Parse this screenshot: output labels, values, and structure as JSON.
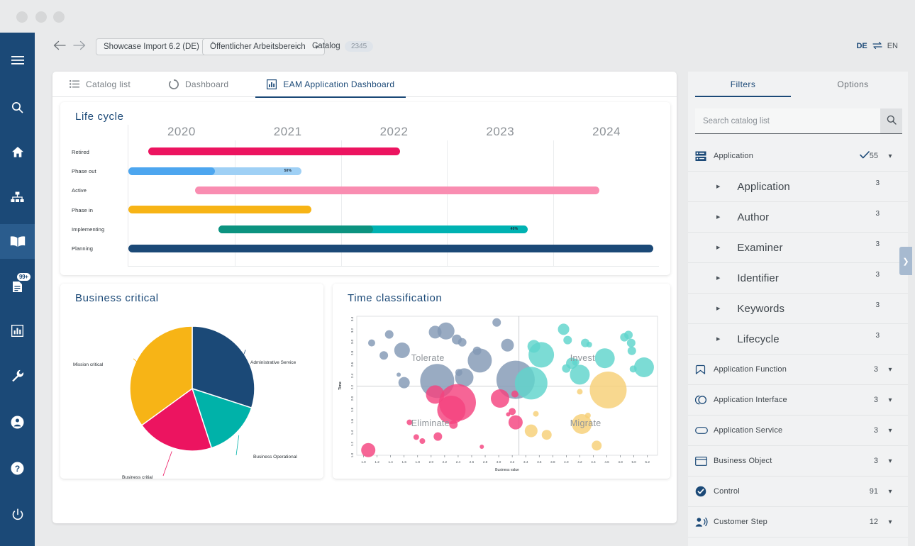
{
  "window": {
    "dots": [
      "minimize",
      "maximize",
      "close"
    ]
  },
  "left_rail": {
    "items": [
      {
        "name": "menu",
        "icon": "hamburger-icon",
        "active": false
      },
      {
        "name": "search",
        "icon": "search-icon",
        "active": false
      },
      {
        "name": "home",
        "icon": "home-icon",
        "active": false
      },
      {
        "name": "organization",
        "icon": "org-chart-icon",
        "active": false
      },
      {
        "name": "catalog",
        "icon": "book-icon",
        "active": true
      },
      {
        "name": "tasks",
        "icon": "document-icon",
        "active": false,
        "badge": "99+"
      },
      {
        "name": "reports",
        "icon": "bar-chart-icon",
        "active": false
      },
      {
        "name": "tools",
        "icon": "wrench-icon",
        "active": false
      }
    ],
    "bottom_items": [
      {
        "name": "account",
        "icon": "user-circle-icon"
      },
      {
        "name": "help",
        "icon": "question-circle-icon"
      },
      {
        "name": "logout",
        "icon": "power-icon"
      }
    ]
  },
  "top_bar": {
    "back_icon": "arrow-left-icon",
    "forward_icon": "arrow-right-icon",
    "import_select": "Showcase Import 6.2 (DE)",
    "workspace_select": "Öffentlicher Arbeitsbereich",
    "catalog_label": "Catalog",
    "catalog_count": "2345",
    "lang_de": "DE",
    "lang_en": "EN",
    "lang_swap_icon": "swap-icon"
  },
  "tabs": [
    {
      "label": "Catalog list",
      "icon": "list-icon",
      "active": false
    },
    {
      "label": "Dashboard",
      "icon": "donut-icon",
      "active": false
    },
    {
      "label": "EAM Application Dashboard",
      "icon": "chart-icon",
      "active": true
    }
  ],
  "panels": {
    "lifecycle_title": "Life cycle",
    "business_critical_title": "Business critical",
    "time_classification_title": "Time classification"
  },
  "chart_data": [
    {
      "type": "bar",
      "id": "life-cycle-gantt",
      "title": "Life cycle",
      "xlabel": "",
      "ylabel": "",
      "grid": true,
      "xlim": [
        2019.5,
        2024.5
      ],
      "tick_labels": [
        "2020",
        "2021",
        "2022",
        "2023",
        "2024"
      ],
      "tick_values": [
        2020,
        2021,
        2022,
        2023,
        2024
      ],
      "categories": [
        "Retired",
        "Phase out",
        "Active",
        "Phase in",
        "Implementing",
        "Planning"
      ],
      "bars": [
        {
          "category": "Retired",
          "start": 2019.69,
          "end": 2022.06,
          "color": "#ec1460",
          "progress": null,
          "progress_label": null,
          "progress_color": null
        },
        {
          "category": "Phase out",
          "start": 2019.5,
          "end": 2021.13,
          "color": "#9fd0f5",
          "progress": 0.5,
          "progress_label": "50%",
          "progress_color": "#4da6ef"
        },
        {
          "category": "Active",
          "start": 2020.13,
          "end": 2023.93,
          "color": "#f98db1",
          "progress": null,
          "progress_label": null,
          "progress_color": null
        },
        {
          "category": "Phase in",
          "start": 2019.5,
          "end": 2021.22,
          "color": "#f7b416",
          "progress": null,
          "progress_label": null,
          "progress_color": null
        },
        {
          "category": "Implementing",
          "start": 2020.35,
          "end": 2023.26,
          "color": "#00b2b2",
          "progress": 0.5,
          "progress_label": "40%",
          "progress_color": "#0c9380"
        },
        {
          "category": "Planning",
          "start": 2019.5,
          "end": 2024.44,
          "color": "#1b4977",
          "progress": null,
          "progress_label": null,
          "progress_color": null
        }
      ]
    },
    {
      "type": "pie",
      "id": "business-critical-pie",
      "title": "Business critical",
      "legend": "callout-labels",
      "slices": [
        {
          "label": "Administrative Service",
          "value": 30,
          "color": "#1b4977"
        },
        {
          "label": "Business Operational",
          "value": 15,
          "color": "#00b2a9"
        },
        {
          "label": "Business critial",
          "value": 20,
          "color": "#ec1460"
        },
        {
          "label": "Mission critical",
          "value": 35,
          "color": "#f7b416"
        }
      ]
    },
    {
      "type": "scatter",
      "id": "time-classification-bubble",
      "title": "Time classification",
      "xlabel": "Business value",
      "ylabel": "Time",
      "grid": false,
      "xlim": [
        0.9,
        5.35
      ],
      "ylim": [
        1.0,
        3.45
      ],
      "xticks": [
        "1.0",
        "1.2",
        "1.4",
        "1.6",
        "1.8",
        "2.0",
        "2.2",
        "2.4",
        "2.6",
        "2.8",
        "3.0",
        "3.2",
        "3.4",
        "3.6",
        "3.8",
        "4.0",
        "4.2",
        "4.4",
        "4.6",
        "4.8",
        "5.0",
        "5.2"
      ],
      "yticks": [
        "1.0",
        "1.2",
        "1.4",
        "1.6",
        "1.8",
        "2.0",
        "2.2",
        "2.4",
        "2.6",
        "2.8",
        "3.0",
        "3.2",
        "3.4"
      ],
      "quadrant_x": 3.3,
      "quadrant_y": 2.22,
      "quadrant_labels": [
        {
          "label": "Tolerate",
          "x": 2.0,
          "y": 2.7
        },
        {
          "label": "Invest",
          "x": 4.35,
          "y": 2.7
        },
        {
          "label": "Eliminate",
          "x": 2.0,
          "y": 1.55
        },
        {
          "label": "Migrate",
          "x": 4.35,
          "y": 1.55
        }
      ],
      "series": [
        {
          "name": "Tolerate",
          "color": "#8399b5",
          "points": [
            {
              "x": 1.12,
              "y": 2.98,
              "r": 5
            },
            {
              "x": 1.3,
              "y": 2.76,
              "r": 6
            },
            {
              "x": 1.38,
              "y": 3.13,
              "r": 6
            },
            {
              "x": 1.52,
              "y": 2.42,
              "r": 3
            },
            {
              "x": 1.57,
              "y": 2.85,
              "r": 11
            },
            {
              "x": 1.6,
              "y": 2.28,
              "r": 8
            },
            {
              "x": 2.06,
              "y": 3.17,
              "r": 9
            },
            {
              "x": 2.22,
              "y": 3.19,
              "r": 12
            },
            {
              "x": 2.09,
              "y": 2.31,
              "r": 24
            },
            {
              "x": 2.38,
              "y": 3.04,
              "r": 7
            },
            {
              "x": 2.46,
              "y": 2.99,
              "r": 6
            },
            {
              "x": 2.41,
              "y": 2.46,
              "r": 5
            },
            {
              "x": 2.49,
              "y": 2.37,
              "r": 13
            },
            {
              "x": 2.68,
              "y": 2.84,
              "r": 6
            },
            {
              "x": 2.72,
              "y": 2.67,
              "r": 17
            },
            {
              "x": 2.97,
              "y": 3.34,
              "r": 6
            },
            {
              "x": 3.13,
              "y": 2.94,
              "r": 9
            },
            {
              "x": 3.25,
              "y": 2.33,
              "r": 27
            }
          ]
        },
        {
          "name": "Eliminate",
          "color": "#f4437f",
          "points": [
            {
              "x": 1.07,
              "y": 1.09,
              "r": 10
            },
            {
              "x": 1.68,
              "y": 1.58,
              "r": 4
            },
            {
              "x": 1.78,
              "y": 1.32,
              "r": 4
            },
            {
              "x": 1.87,
              "y": 1.25,
              "r": 4
            },
            {
              "x": 2.06,
              "y": 2.07,
              "r": 13
            },
            {
              "x": 2.1,
              "y": 1.33,
              "r": 6
            },
            {
              "x": 2.3,
              "y": 1.8,
              "r": 20
            },
            {
              "x": 2.33,
              "y": 1.54,
              "r": 6
            },
            {
              "x": 2.39,
              "y": 1.93,
              "r": 26
            },
            {
              "x": 2.75,
              "y": 1.15,
              "r": 3
            },
            {
              "x": 3.02,
              "y": 2.0,
              "r": 13
            },
            {
              "x": 3.14,
              "y": 1.72,
              "r": 3
            },
            {
              "x": 3.2,
              "y": 1.77,
              "r": 5
            },
            {
              "x": 3.24,
              "y": 2.08,
              "r": 5
            },
            {
              "x": 3.25,
              "y": 1.58,
              "r": 10
            }
          ]
        },
        {
          "name": "Invest",
          "color": "#5fd4cc",
          "points": [
            {
              "x": 3.52,
              "y": 2.92,
              "r": 9
            },
            {
              "x": 3.63,
              "y": 2.77,
              "r": 18
            },
            {
              "x": 3.48,
              "y": 2.27,
              "r": 23
            },
            {
              "x": 3.96,
              "y": 3.22,
              "r": 8
            },
            {
              "x": 4.02,
              "y": 3.03,
              "r": 6
            },
            {
              "x": 4.08,
              "y": 2.62,
              "r": 8
            },
            {
              "x": 4.14,
              "y": 2.64,
              "r": 5
            },
            {
              "x": 4.0,
              "y": 2.53,
              "r": 6
            },
            {
              "x": 4.2,
              "y": 2.42,
              "r": 14
            },
            {
              "x": 4.28,
              "y": 2.98,
              "r": 6
            },
            {
              "x": 4.34,
              "y": 2.95,
              "r": 4
            },
            {
              "x": 4.57,
              "y": 2.71,
              "r": 14
            },
            {
              "x": 4.86,
              "y": 3.08,
              "r": 6
            },
            {
              "x": 4.92,
              "y": 3.12,
              "r": 6
            },
            {
              "x": 4.96,
              "y": 2.98,
              "r": 6
            },
            {
              "x": 4.97,
              "y": 2.84,
              "r": 6
            },
            {
              "x": 4.99,
              "y": 2.52,
              "r": 5
            },
            {
              "x": 5.15,
              "y": 2.55,
              "r": 14
            }
          ]
        },
        {
          "name": "Migrate",
          "color": "#f7cf76",
          "points": [
            {
              "x": 3.55,
              "y": 1.73,
              "r": 4
            },
            {
              "x": 3.48,
              "y": 1.43,
              "r": 9
            },
            {
              "x": 3.71,
              "y": 1.36,
              "r": 7
            },
            {
              "x": 4.2,
              "y": 2.12,
              "r": 4
            },
            {
              "x": 4.23,
              "y": 1.55,
              "r": 14
            },
            {
              "x": 4.32,
              "y": 1.7,
              "r": 4
            },
            {
              "x": 4.45,
              "y": 1.17,
              "r": 7
            },
            {
              "x": 4.62,
              "y": 2.15,
              "r": 26
            }
          ]
        }
      ]
    }
  ],
  "right_panel": {
    "tabs": [
      {
        "label": "Filters",
        "active": true
      },
      {
        "label": "Options",
        "active": false
      }
    ],
    "search_placeholder": "Search catalog list",
    "search_value": "",
    "search_icon": "search-icon",
    "handle_icon": "chevron-right-icon",
    "filters": [
      {
        "label": "Application",
        "count": "55",
        "icon": "server-icon",
        "checked": true,
        "type": "group",
        "chevron": "chevron-down-icon"
      },
      {
        "label": "Application",
        "count": "3",
        "type": "sub",
        "triangle": "triangle-right-icon"
      },
      {
        "label": "Author",
        "count": "3",
        "type": "sub",
        "triangle": "triangle-right-icon"
      },
      {
        "label": "Examiner",
        "count": "3",
        "type": "sub",
        "triangle": "triangle-right-icon"
      },
      {
        "label": "Identifier",
        "count": "3",
        "type": "sub",
        "triangle": "triangle-right-icon"
      },
      {
        "label": "Keywords",
        "count": "3",
        "type": "sub",
        "triangle": "triangle-right-icon"
      },
      {
        "label": "Lifecycle",
        "count": "3",
        "type": "sub",
        "triangle": "triangle-right-icon"
      },
      {
        "label": "Application Function",
        "count": "3",
        "icon": "bookmark-icon",
        "type": "group",
        "chevron": "chevron-down-icon"
      },
      {
        "label": "Application Interface",
        "count": "3",
        "icon": "interface-icon",
        "type": "group",
        "chevron": "chevron-down-icon"
      },
      {
        "label": "Application Service",
        "count": "3",
        "icon": "pill-icon",
        "type": "group",
        "chevron": "chevron-down-icon"
      },
      {
        "label": "Business Object",
        "count": "3",
        "icon": "rectangle-icon",
        "type": "group",
        "chevron": "chevron-down-icon"
      },
      {
        "label": "Control",
        "count": "91",
        "icon": "check-circle-icon",
        "type": "group",
        "chevron": "chevron-down-icon"
      },
      {
        "label": "Customer Step",
        "count": "12",
        "icon": "person-speaking-icon",
        "type": "group",
        "chevron": "chevron-down-icon"
      }
    ]
  }
}
